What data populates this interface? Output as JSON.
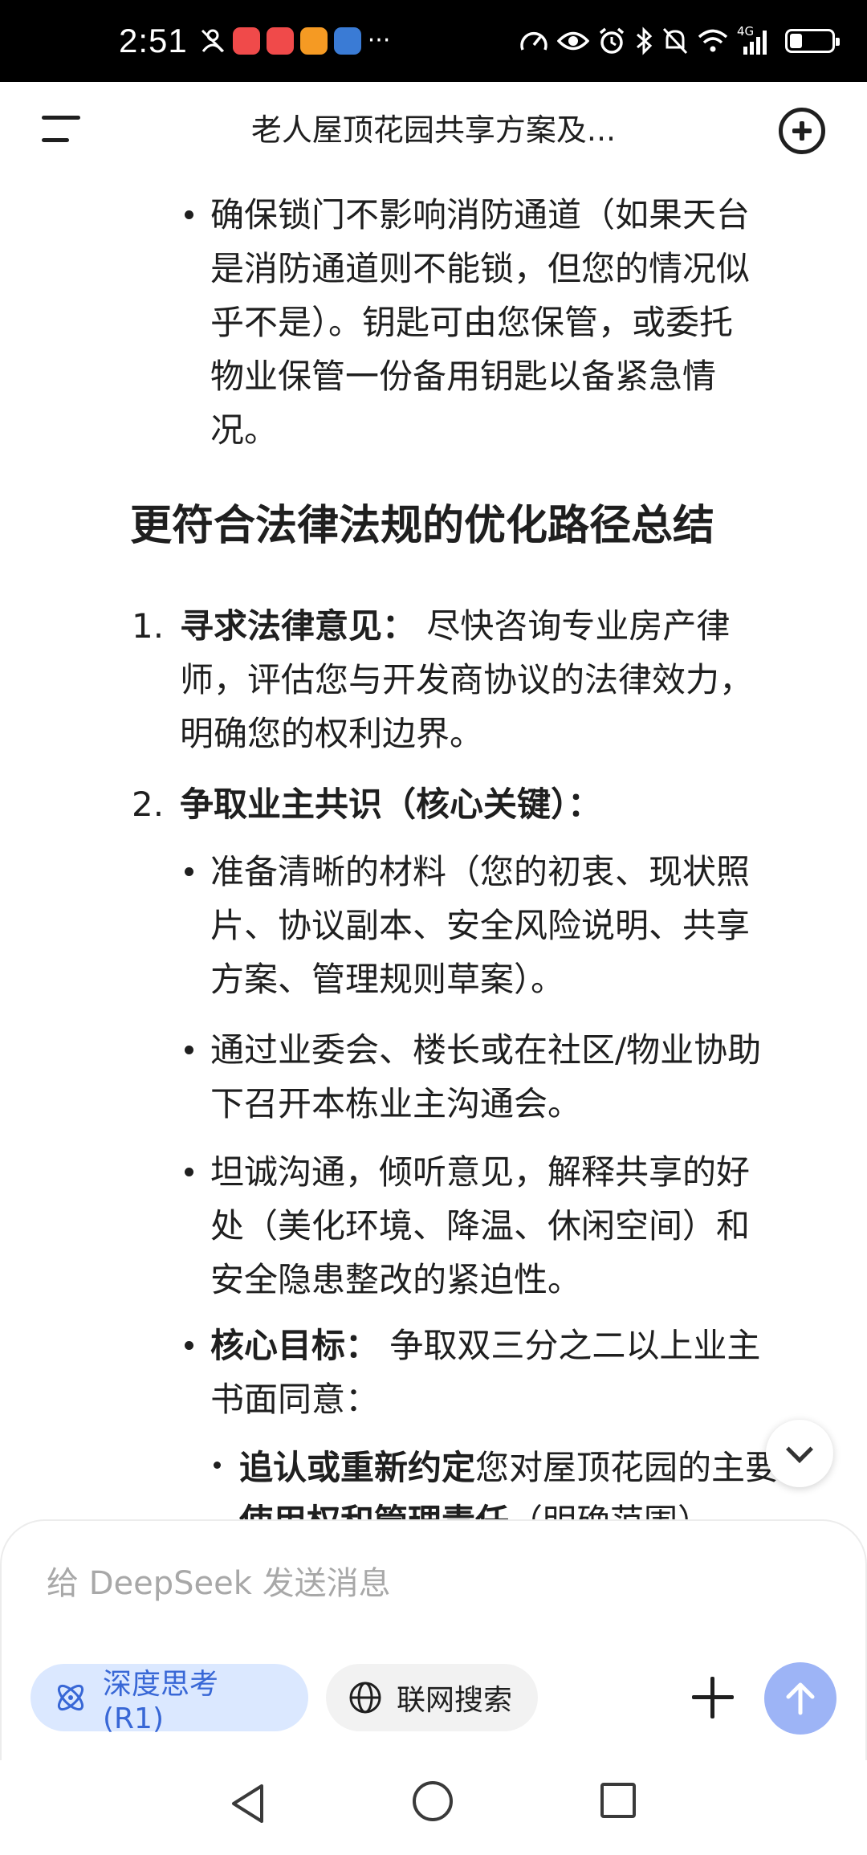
{
  "status_bar": {
    "time": "2:51",
    "left_icons": [
      "silent-person-icon",
      "app-icon-red",
      "app-icon-red",
      "app-icon-orange",
      "app-icon-blue",
      "more-dots-icon"
    ],
    "more_glyph": "···",
    "net_label": "4G",
    "battery_level": 0.3,
    "colors": {
      "app_red": "#f04a4a",
      "app_orange": "#f59a23",
      "app_blue": "#3a7bd5"
    }
  },
  "header": {
    "title": "老人屋顶花园共享方案及..."
  },
  "content": {
    "bullet_top": {
      "lines": [
        "确保锁门不影响消防通道（如果天台",
        "是消防通道则不能锁，但您的情况似",
        "乎不是）。钥匙可由您保管，或委托",
        "物业保管一份备用钥匙以备紧急情",
        "况。"
      ]
    },
    "heading": "更符合法律法规的优化路径总结",
    "item1": {
      "num": "1.",
      "bold": "寻求法律意见：",
      "line1_rest": " 尽快咨询专业房产律",
      "lines": [
        "师，评估您与开发商协议的法律效力，",
        "明确您的权利边界。"
      ]
    },
    "item2": {
      "num": "2.",
      "bold": "争取业主共识（核心关键）："
    },
    "sub_bullets": [
      {
        "lines": [
          "准备清晰的材料（您的初衷、现状照",
          "片、协议副本、安全风险说明、共享",
          "方案、管理规则草案）。"
        ]
      },
      {
        "lines": [
          "通过业委会、楼长或在社区/物业协助",
          "下召开本栋业主沟通会。"
        ]
      },
      {
        "lines": [
          "坦诚沟通，倾听意见，解释共享的好",
          "处（美化环境、降温、休闲空间）和",
          "安全隐患整改的紧迫性。"
        ]
      }
    ],
    "core_goal": {
      "bold": "核心目标：",
      "line1_rest": " 争取双三分之二以上业主",
      "line2": "书面同意："
    },
    "sub_sub": {
      "bold": "追认或重新约定",
      "rest": "您对屋顶花园的主要",
      "line2_bold": "使用权和管理责任",
      "line2_rest": "（明确范围）。"
    }
  },
  "composer": {
    "placeholder": "给 DeepSeek 发送消息",
    "deep_think_label": "深度思考 (R1)",
    "web_search_label": "联网搜索"
  },
  "colors": {
    "accent_blue": "#3867d6",
    "chip_blue_bg": "#dbe8ff",
    "send_button": "#9db4f6"
  }
}
